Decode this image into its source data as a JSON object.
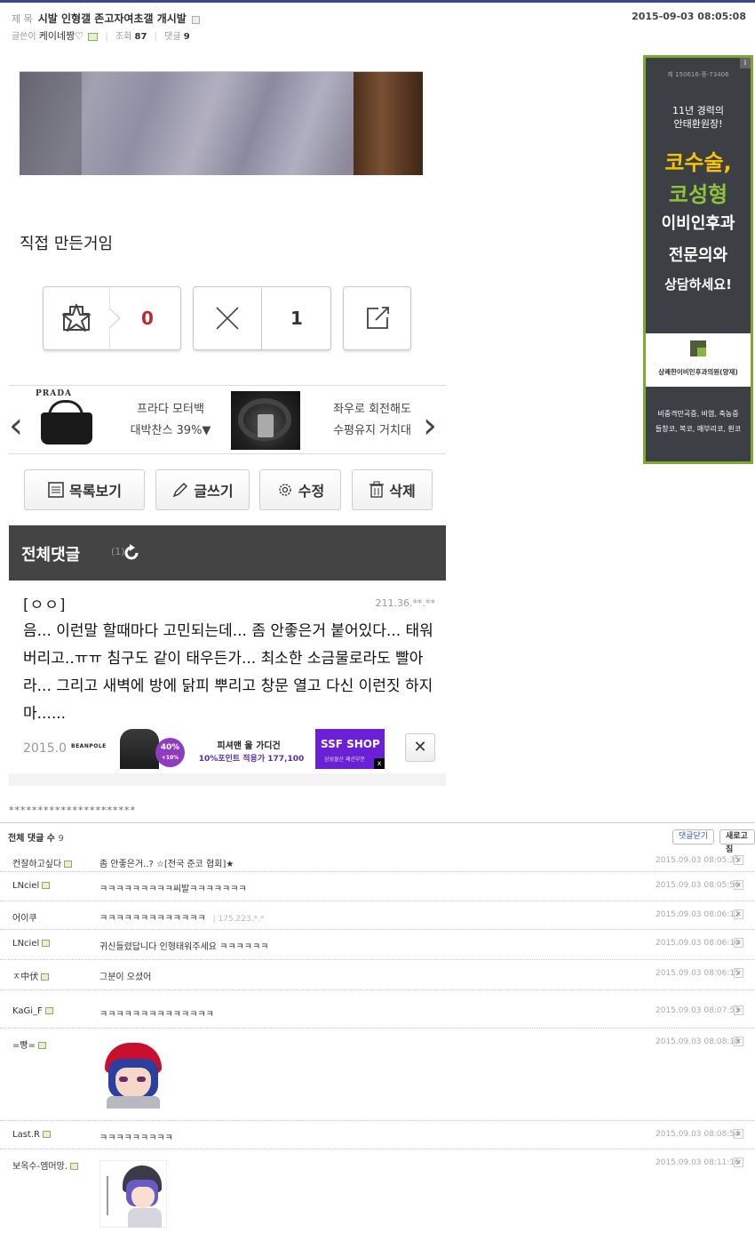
{
  "header": {
    "title_label": "제 목",
    "title": "시발 인형갤 존고자여초갤 개시발",
    "date": "2015-09-03 08:05:08",
    "writer_label": "글쓴이",
    "writer": "케이네짱♡",
    "views_label": "조회",
    "views": "87",
    "comments_label": "댓글",
    "comments": "9"
  },
  "post": {
    "body": "직접 만든거임"
  },
  "votes": {
    "recommend": "0",
    "unrecommend": "1"
  },
  "banner": {
    "brand": "PRADA",
    "item1_line1": "프라다 모터백",
    "item1_line2": "대박찬스 39%▼",
    "item2_line1": "좌우로 회전해도",
    "item2_line2": "수평유지 거치대"
  },
  "actions": {
    "list": "목록보기",
    "write": "글쓰기",
    "edit": "수정",
    "delete": "삭제"
  },
  "comment_section": {
    "title": "전체댓글",
    "count": "(1)"
  },
  "top_comment": {
    "nick": "[ㅇㅇ]",
    "ip": "211.36.**.**",
    "body": "음... 이런말 할때마다 고민되는데... 좀 안좋은거 붙어있다... 태워버리고..ㅠㅠ 침구도 같이 태우든가... 최소한 소금물로라도 빨아라... 그리고 새벽에 방에 닭피 뿌리고 창문 열고 다신 이런짓 하지마......",
    "date": "2015.0"
  },
  "inline_ad": {
    "brand": "BEANPOLE",
    "badge": "40%",
    "badge_sub": "+10%",
    "line1": "피셔맨 울 가디건",
    "line2": "10%포인트 적용가 177,100",
    "shop": "SSF SHOP",
    "shop_sub": "삼성물산 패션부문",
    "close": "✕"
  },
  "divider": "**********************",
  "comment_list": {
    "label": "전체 댓글 수",
    "count": "9",
    "btn_fold": "댓글닫기",
    "btn_refresh": "새로고침",
    "items": [
      {
        "nick": "컨잘하고싶다",
        "text": "좀 안좋은거..? ☆[전국 준코 협회]★",
        "date": "2015.09.03 08:05:35"
      },
      {
        "nick": "LNciel",
        "text": "ㅋㅋㅋㅋㅋㅋㅋㅋㅋ씨발ㅋㅋㅋㅋㅋㅋㅋ",
        "date": "2015.09.03 08:05:56"
      },
      {
        "nick": "어이쿠",
        "text": "ㅋㅋㅋㅋㅋㅋㅋㅋㅋㅋㅋㅋㅋ",
        "ip": "175.223.*.*",
        "date": "2015.09.03 08:06:12"
      },
      {
        "nick": "LNciel",
        "text": "귀신들렸답니다 인형태워주세요 ㅋㅋㅋㅋㅋㅋ",
        "date": "2015.09.03 08:06:10"
      },
      {
        "nick": "ㅈ中伏",
        "text": "그분이 오셨어",
        "date": "2015.09.03 08:06:15"
      },
      {
        "nick": "KaGi_F",
        "text": "ㅋㅋㅋㅋㅋㅋㅋㅋㅋㅋㅋㅋㅋㅋ",
        "date": "2015.09.03 08:07:53"
      },
      {
        "nick": "=빵=",
        "text": "",
        "date": "2015.09.03 08:08:18"
      },
      {
        "nick": "Last.R",
        "text": "ㅋㅋㅋㅋㅋㅋㅋㅋㅋ",
        "date": "2015.09.03 08:08:54"
      },
      {
        "nick": "보옥수-엠머망.",
        "text": "",
        "date": "2015.09.03 08:11:16"
      }
    ]
  },
  "side_ad": {
    "reg_no": "제 150616-중-73406",
    "line1": "11년 경력의",
    "line2": "안태환원장!",
    "big1": "코수술,",
    "big2": "코성형",
    "big3": "이비인후과",
    "big4": "전문의와",
    "big5": "상담하세요!",
    "clinic": "상쾌한이비인후과의원(양재)",
    "bottom1": "비중격만곡증, 비염, 축농증",
    "bottom2": "들창코, 복코, 매부리코, 휜코",
    "info": "i"
  },
  "colors": {
    "accent": "#3b4890",
    "vote_red": "#c0282d",
    "ad_green": "#7fa832",
    "ad_orange": "#f7c200"
  }
}
